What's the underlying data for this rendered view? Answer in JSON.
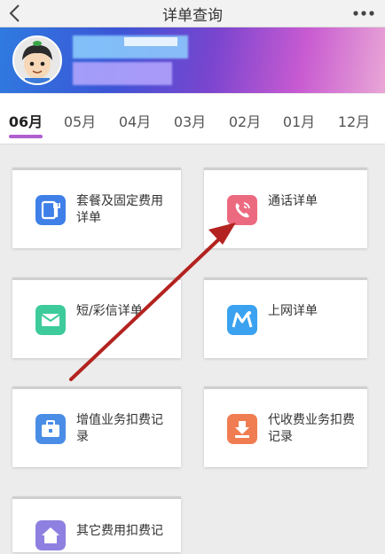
{
  "header": {
    "title": "详单查询",
    "back_icon": "chevron-left-icon",
    "more_icon": "more-dots-icon"
  },
  "tabs": [
    {
      "label": "06月",
      "active": true
    },
    {
      "label": "05月",
      "active": false
    },
    {
      "label": "04月",
      "active": false
    },
    {
      "label": "03月",
      "active": false
    },
    {
      "label": "02月",
      "active": false
    },
    {
      "label": "01月",
      "active": false
    },
    {
      "label": "12月",
      "active": false
    }
  ],
  "cards": [
    {
      "label_line1": "套餐及固定费用",
      "label_line2": "详单",
      "icon": "package-icon",
      "icon_color": "#3f7fe8"
    },
    {
      "label_line1": "通话详单",
      "label_line2": "",
      "icon": "phone-call-icon",
      "icon_color": "#ec6a7f"
    },
    {
      "label_line1": "短/彩信详单",
      "label_line2": "",
      "icon": "envelope-icon",
      "icon_color": "#3ecb9c"
    },
    {
      "label_line1": "上网详单",
      "label_line2": "",
      "icon": "mobile-data-icon",
      "icon_color": "#3aa2f0"
    },
    {
      "label_line1": "增值业务扣费记",
      "label_line2": "录",
      "icon": "briefcase-icon",
      "icon_color": "#4a8de6"
    },
    {
      "label_line1": "代收费业务扣费",
      "label_line2": "记录",
      "icon": "download-box-icon",
      "icon_color": "#f07d52"
    },
    {
      "label_line1": "其它费用扣费记",
      "label_line2": "",
      "icon": "house-icon",
      "icon_color": "#8d80e0"
    }
  ],
  "colors": {
    "accent_underline": "#b05fd0",
    "annotation_arrow": "#b3231f"
  }
}
